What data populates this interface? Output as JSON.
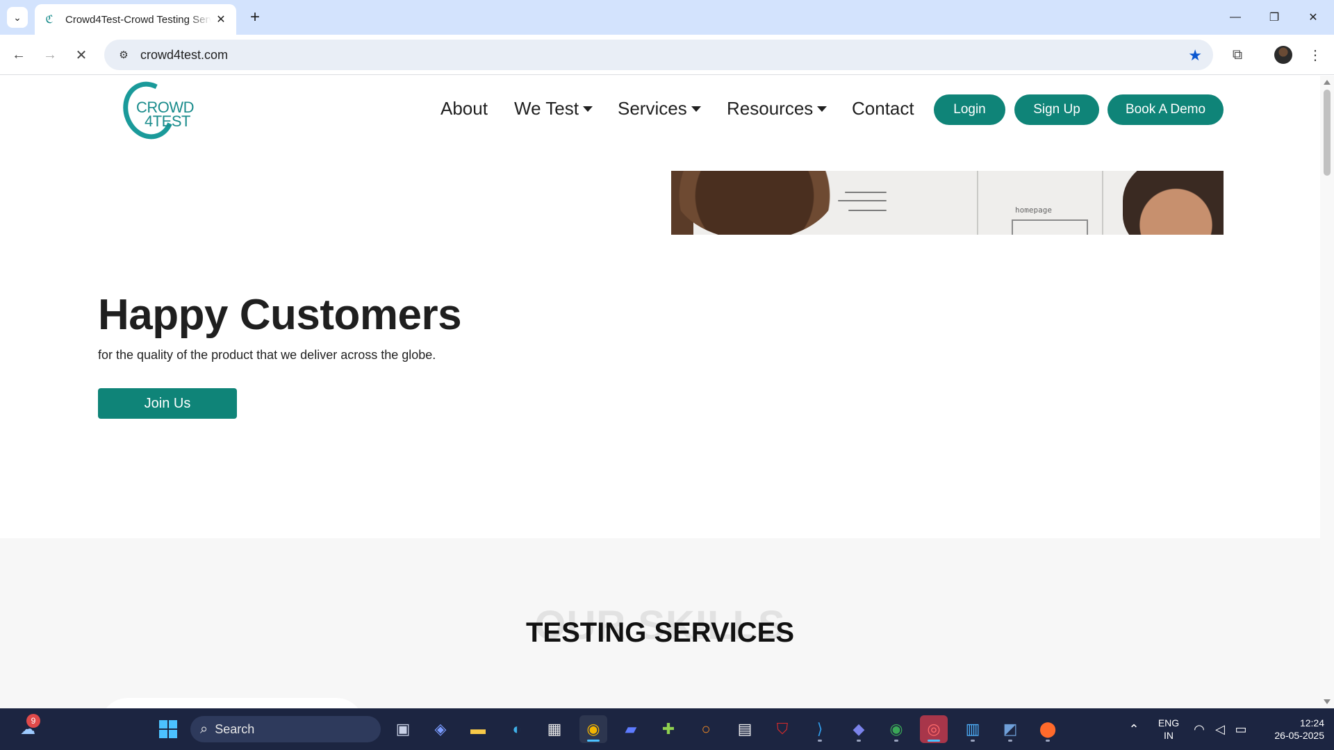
{
  "browser": {
    "tab_title": "Crowd4Test-Crowd Testing Services",
    "url": "crowd4test.com",
    "colors": {
      "tabbar": "#d3e3fd",
      "star": "#0b57d0"
    }
  },
  "site": {
    "logo": {
      "line1": "CROWD",
      "line2": "4TEST"
    },
    "nav": {
      "about": "About",
      "we_test": "We Test",
      "services": "Services",
      "resources": "Resources",
      "contact": "Contact"
    },
    "buttons": {
      "login": "Login",
      "signup": "Sign Up",
      "book_demo": "Book A Demo"
    },
    "hero_image_text": "homepage",
    "hero": {
      "title": "Happy Customers",
      "subtitle": "for the quality of the product that we deliver across the globe.",
      "cta": "Join Us"
    },
    "skills": {
      "background_text": "OUR SKILLS",
      "title": "TESTING SERVICES"
    },
    "accent_color": "#0f8478"
  },
  "taskbar": {
    "search_placeholder": "Search",
    "notification_count": "9",
    "language": {
      "line1": "ENG",
      "line2": "IN"
    },
    "time": "12:24",
    "date": "26-05-2025"
  }
}
